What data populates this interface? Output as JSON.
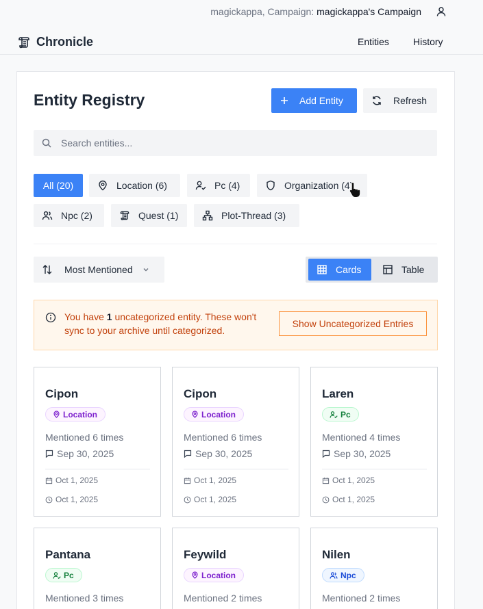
{
  "topbar": {
    "user_prefix": "magickappa, Campaign: ",
    "campaign": "magickappa's Campaign",
    "user_icon": "user-icon"
  },
  "nav": {
    "brand": "Chronicle",
    "links": [
      "Entities",
      "History"
    ]
  },
  "page": {
    "title": "Entity Registry",
    "add_label": "Add Entity",
    "refresh_label": "Refresh"
  },
  "search": {
    "placeholder": "Search entities..."
  },
  "filters": [
    {
      "label": "All (20)",
      "active": true
    },
    {
      "label": "Location (6)",
      "icon": "map-pin-icon"
    },
    {
      "label": "Pc (4)",
      "icon": "user-check-icon"
    },
    {
      "label": "Organization (4)",
      "icon": "shield-icon"
    },
    {
      "label": "Npc (2)",
      "icon": "users-icon"
    },
    {
      "label": "Quest (1)",
      "icon": "scroll-icon"
    },
    {
      "label": "Plot-Thread (3)",
      "icon": "network-icon"
    }
  ],
  "sort": {
    "label": "Most Mentioned"
  },
  "view": {
    "cards_label": "Cards",
    "table_label": "Table",
    "active": "Cards"
  },
  "alert": {
    "prefix": "You have ",
    "count": "1",
    "suffix": " uncategorized entity. These won't sync to your archive until categorized.",
    "button": "Show Uncategorized Entries"
  },
  "entities": [
    {
      "name": "Cipon",
      "type": "Location",
      "mentions": "Mentioned 6 times",
      "last": "Sep 30, 2025",
      "created": "Oct 1, 2025",
      "updated": "Oct 1, 2025"
    },
    {
      "name": "Cipon",
      "type": "Location",
      "mentions": "Mentioned 6 times",
      "last": "Sep 30, 2025",
      "created": "Oct 1, 2025",
      "updated": "Oct 1, 2025"
    },
    {
      "name": "Laren",
      "type": "Pc",
      "mentions": "Mentioned 4 times",
      "last": "Sep 30, 2025",
      "created": "Oct 1, 2025",
      "updated": "Oct 1, 2025"
    },
    {
      "name": "Pantana",
      "type": "Pc",
      "mentions": "Mentioned 3 times"
    },
    {
      "name": "Feywild",
      "type": "Location",
      "mentions": "Mentioned 2 times"
    },
    {
      "name": "Nilen",
      "type": "Npc",
      "mentions": "Mentioned 2 times"
    }
  ],
  "colors": {
    "accent": "#3b82f6",
    "warning_text": "#c2410c",
    "warning_bg": "#fff7ed"
  }
}
